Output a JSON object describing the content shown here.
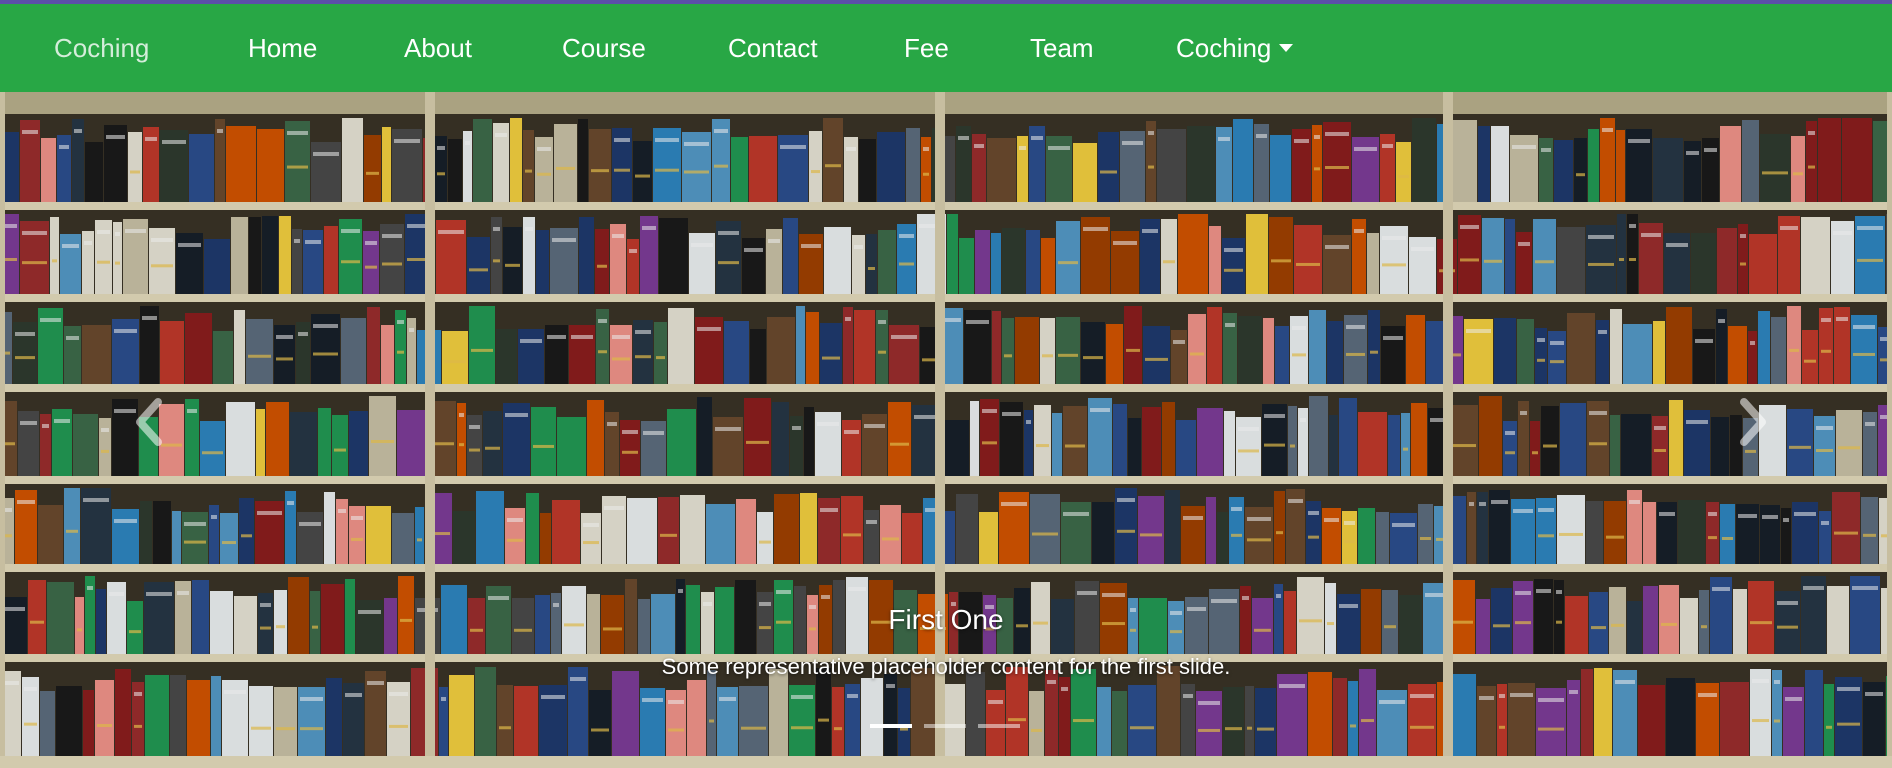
{
  "navbar": {
    "brand": "Coching",
    "links": [
      "Home",
      "About",
      "Course",
      "Contact",
      "Fee",
      "Team"
    ],
    "dropdown_label": "Coching",
    "background_color": "#28a745"
  },
  "carousel": {
    "slide_title": "First One",
    "slide_text": "Some representative placeholder content for the first slide.",
    "indicator_count": 3,
    "active_index": 0,
    "prev_icon": "chevron-left-icon",
    "next_icon": "chevron-right-icon"
  }
}
